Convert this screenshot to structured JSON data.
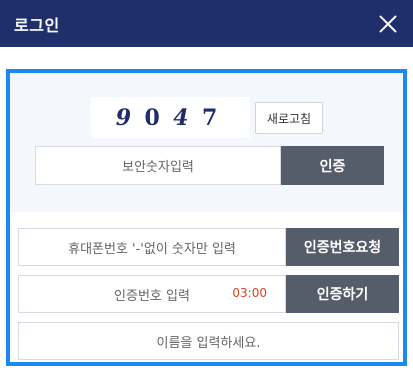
{
  "header": {
    "title": "로그인",
    "close_icon": "close-icon"
  },
  "captcha": {
    "digits": [
      "9",
      "0",
      "4",
      "7"
    ],
    "refresh_label": "새로고침",
    "input_placeholder": "보안숫자입력",
    "verify_label": "인증"
  },
  "phone": {
    "input_placeholder": "휴대폰번호 '-'없이 숫자만 입력",
    "request_label": "인증번호요청"
  },
  "code": {
    "input_placeholder": "인증번호 입력",
    "timer": "03:00",
    "submit_label": "인증하기"
  },
  "name": {
    "input_placeholder": "이름을 입력하세요."
  },
  "colors": {
    "header_bg": "#1e2f6c",
    "frame_border": "#1e88f0",
    "button_bg": "#555d6b",
    "timer": "#d8452a"
  }
}
